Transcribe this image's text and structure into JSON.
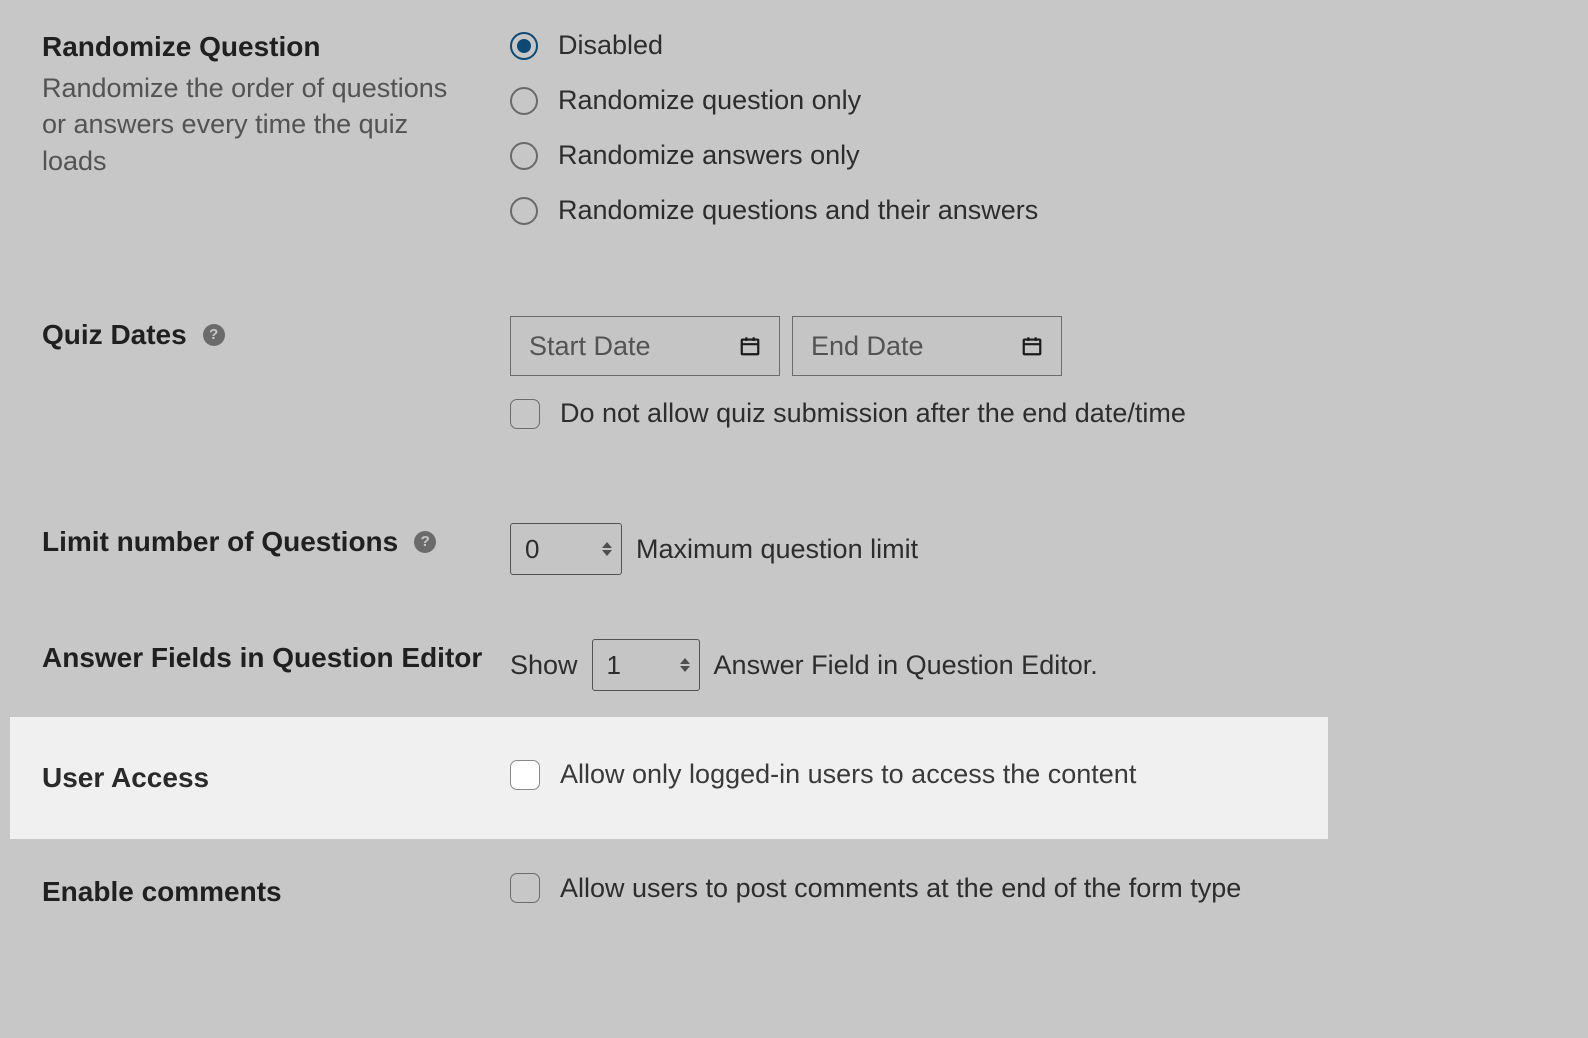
{
  "randomize": {
    "title": "Randomize Question",
    "desc": "Randomize the order of questions or answers every time the quiz loads",
    "options": [
      "Disabled",
      "Randomize question only",
      "Randomize answers only",
      "Randomize questions and their answers"
    ],
    "selected_index": 0
  },
  "quiz_dates": {
    "title": "Quiz Dates",
    "start_placeholder": "Start Date",
    "end_placeholder": "End Date",
    "no_submission_label": "Do not allow quiz submission after the end date/time",
    "no_submission_checked": false
  },
  "limit_questions": {
    "title": "Limit number of Questions",
    "value": "0",
    "suffix": "Maximum question limit"
  },
  "answer_fields": {
    "title": "Answer Fields in Question Editor",
    "prefix": "Show",
    "value": "1",
    "suffix": "Answer Field in Question Editor."
  },
  "user_access": {
    "title": "User Access",
    "label": "Allow only logged-in users to access the content",
    "checked": false
  },
  "enable_comments": {
    "title": "Enable comments",
    "label": "Allow users to post comments at the end of the form type",
    "checked": false
  },
  "icons": {
    "help_glyph": "?"
  }
}
